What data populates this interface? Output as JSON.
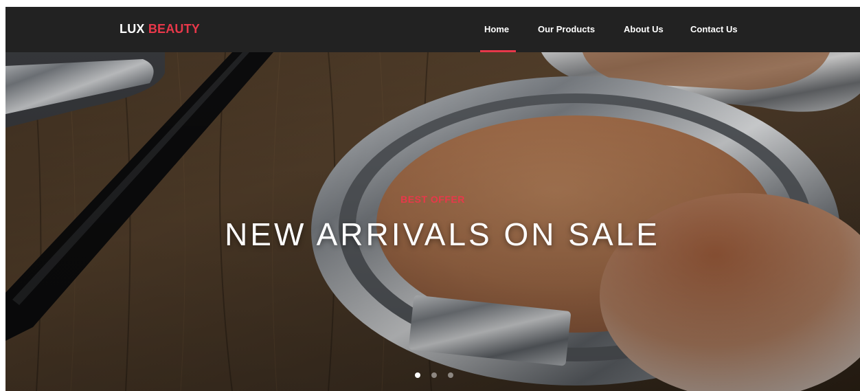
{
  "brand": {
    "part1": "LUX",
    "part2": "BEAUTY"
  },
  "nav": {
    "items": [
      {
        "label": "Home",
        "active": true
      },
      {
        "label": "Our Products",
        "active": false
      },
      {
        "label": "About Us",
        "active": false
      },
      {
        "label": "Contact Us",
        "active": false
      }
    ]
  },
  "hero": {
    "eyebrow": "BEST OFFER",
    "headline": "NEW ARRIVALS ON SALE",
    "slide_count": 3,
    "active_slide": 1
  },
  "colors": {
    "navbar_bg": "#222222",
    "accent": "#e8384a",
    "text_light": "#ffffff"
  }
}
